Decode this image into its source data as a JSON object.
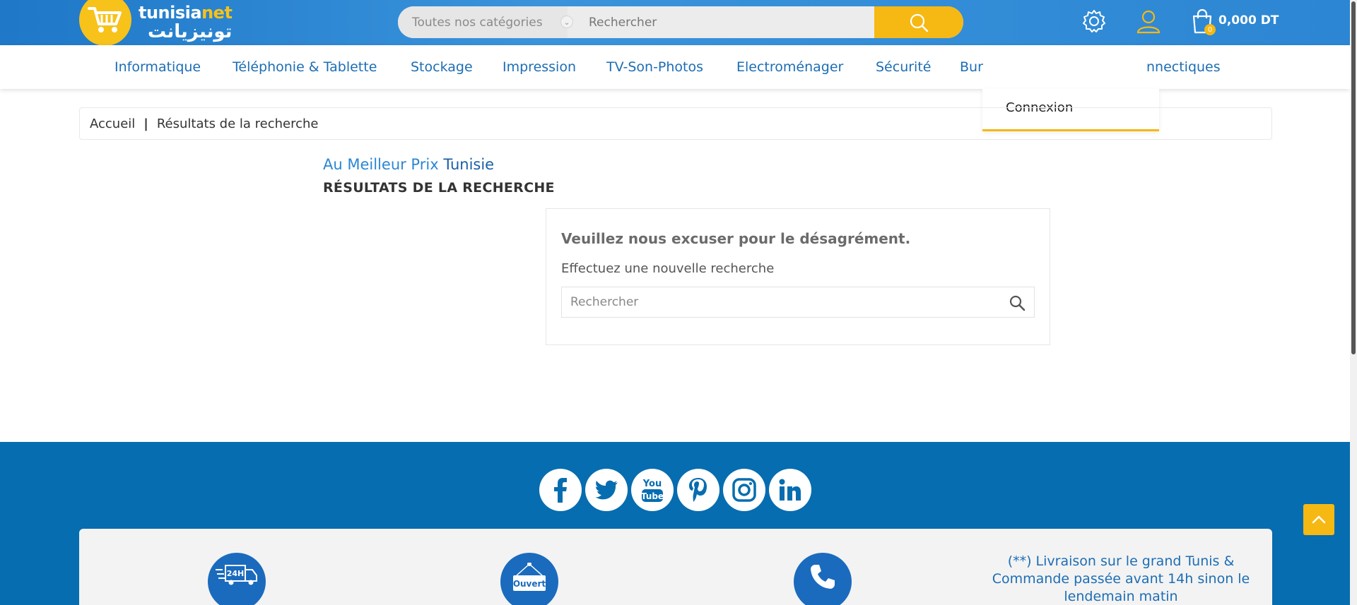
{
  "header": {
    "logo": {
      "line1_a": "tunisia",
      "line1_b": "net",
      "line2": "تونيزيانت"
    },
    "search": {
      "category_placeholder": "Toutes nos catégories",
      "placeholder": "Rechercher"
    },
    "cart": {
      "amount": "0,000 DT",
      "count": "0"
    },
    "icons": [
      "gear-icon",
      "user-icon",
      "shopping-bag-icon"
    ],
    "colors": {
      "brand_blue": "#2c86d3",
      "accent_yellow": "#f6b813"
    }
  },
  "nav": {
    "items": [
      {
        "label": "Informatique"
      },
      {
        "label": "Téléphonie & Tablette"
      },
      {
        "label": "Stockage"
      },
      {
        "label": "Impression"
      },
      {
        "label": "TV-Son-Photos"
      },
      {
        "label": "Electroménager"
      },
      {
        "label": "Sécurité"
      },
      {
        "label": "Bur"
      },
      {
        "label": "nnectiques"
      }
    ]
  },
  "account_dropdown": {
    "login_label": "Connexion"
  },
  "breadcrumb": {
    "home": "Accueil",
    "separator": "|",
    "current": "Résultats de la recherche"
  },
  "main": {
    "subtitle_a": "Au Meilleur Prix",
    "subtitle_b": "Tunisie",
    "results_title": "RÉSULTATS DE LA RECHERCHE",
    "no_results": {
      "title": "Veuillez nous excuser pour le désagrément.",
      "subtitle": "Effectuez une nouvelle recherche",
      "placeholder": "Rechercher"
    }
  },
  "footer": {
    "social": [
      "facebook-icon",
      "twitter-icon",
      "youtube-icon",
      "pinterest-icon",
      "instagram-icon",
      "linkedin-icon"
    ],
    "info": {
      "delivery_badge": "24H",
      "open_sign": "Ouvert",
      "delivery_note": "(**) Livraison sur le grand Tunis & Commande passée avant 14h sinon le lendemain matin"
    }
  }
}
